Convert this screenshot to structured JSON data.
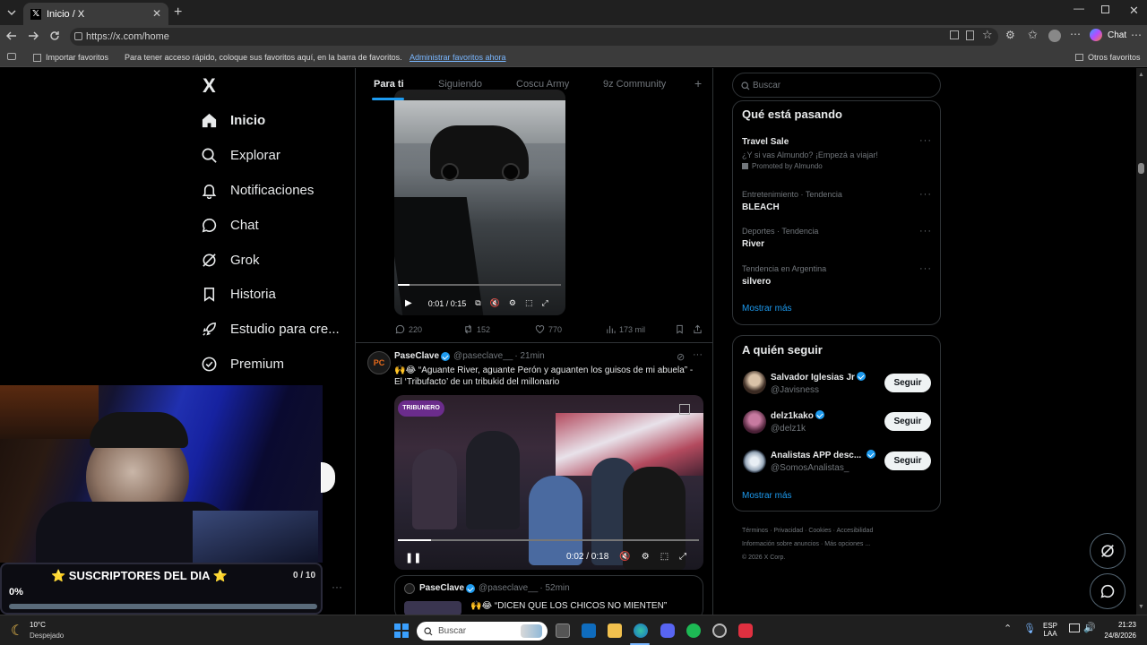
{
  "browser": {
    "tab_title": "Inicio / X",
    "url": "https://x.com/home",
    "chat_label": "Chat",
    "fav_import": "Importar favoritos",
    "fav_hint": "Para tener acceso rápido, coloque sus favoritos aquí, en la barra de favoritos.",
    "fav_manage": "Administrar favoritos ahora",
    "fav_other": "Otros favoritos"
  },
  "sidebar": {
    "logo": "X",
    "items": [
      {
        "label": "Inicio",
        "icon": "home-icon"
      },
      {
        "label": "Explorar",
        "icon": "search-icon"
      },
      {
        "label": "Notificaciones",
        "icon": "bell-icon"
      },
      {
        "label": "Chat",
        "icon": "chat-bubble-icon"
      },
      {
        "label": "Grok",
        "icon": "grok-icon"
      },
      {
        "label": "Historia",
        "icon": "bookmark-icon"
      },
      {
        "label": "Estudio para cre...",
        "icon": "rocket-icon"
      },
      {
        "label": "Premium",
        "icon": "premium-check-icon"
      }
    ]
  },
  "feed": {
    "tabs": [
      "Para ti",
      "Siguiendo",
      "Coscu Army",
      "9z Community"
    ],
    "video1": {
      "time": "0:01 / 0:15",
      "progress": 0.07
    },
    "actions1": {
      "replies": "220",
      "reposts": "152",
      "likes": "770",
      "views": "173 mil"
    },
    "post2": {
      "author": "PaseClave",
      "handle": "@paseclave__",
      "time": "· 21min",
      "avatar_text": "PC",
      "text_line1": "🙌😂 “Aguante River, aguante Perón y aguanten los guisos de mi abuela” -",
      "text_line2": "El ‘Tribufacto’ de un tribukid del millonario",
      "video_badge": "TRIBUNERO",
      "video_time": "0:02 / 0:18",
      "progress": 0.11
    },
    "quoted": {
      "author": "PaseClave",
      "handle": "@paseclave__",
      "time": "· 52min",
      "text": "🙌😂 “DICEN QUE LOS CHICOS NO MIENTEN”"
    }
  },
  "right": {
    "search_placeholder": "Buscar",
    "trends_title": "Qué está pasando",
    "trends": [
      {
        "cat": "",
        "name": "Travel Sale",
        "desc": "¿Y si vas Almundo? ¡Empezá a viajar!",
        "promo": "Promoted by Almundo"
      },
      {
        "cat": "Entretenimiento · Tendencia",
        "name": "BLEACH"
      },
      {
        "cat": "Deportes · Tendencia",
        "name": "River"
      },
      {
        "cat": "Tendencia en Argentina",
        "name": "silvero"
      }
    ],
    "show_more": "Mostrar más",
    "follow_title": "A quién seguir",
    "follow": [
      {
        "name": "Salvador Iglesias Jr",
        "handle": "@Javisness",
        "button": "Seguir"
      },
      {
        "name": "delz1kako",
        "handle": "@delz1k",
        "button": "Seguir"
      },
      {
        "name": "Analistas APP desc...",
        "handle": "@SomosAnalistas_",
        "button": "Seguir"
      }
    ],
    "show_more2": "Mostrar más",
    "footer": {
      "l1": [
        "Términos",
        "Privacidad",
        "Cookies",
        "Accesibilidad"
      ],
      "l2": [
        "Información sobre anuncios",
        "Más opciones ..."
      ],
      "l3": "© 2026 X Corp."
    }
  },
  "overlay": {
    "subs_title": "⭐ SUSCRIPTORES DEL DIA ⭐",
    "subs_count": "0 / 10",
    "subs_pct": "0%",
    "subs_progress": 0
  },
  "taskbar": {
    "temp": "10°C",
    "weather": "Despejado",
    "search": "Buscar",
    "lang1": "ESP",
    "lang2": "LAA",
    "time": "21:23",
    "date": "24/8/2026"
  },
  "colors": {
    "accent": "#1d9bf0",
    "bg": "#000000",
    "muted": "#71767b"
  }
}
